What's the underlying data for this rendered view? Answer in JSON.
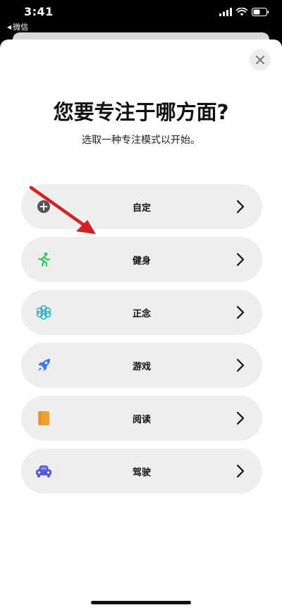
{
  "status_bar": {
    "time": "3:41",
    "back_app": "微信"
  },
  "sheet": {
    "title": "您要专注于哪方面?",
    "subtitle": "选取一种专注模式以开始。"
  },
  "focus_modes": [
    {
      "label": "自定",
      "icon": "plus-circle-icon",
      "color": "#555555"
    },
    {
      "label": "健身",
      "icon": "running-figure-icon",
      "color": "#34c759"
    },
    {
      "label": "正念",
      "icon": "flower-icon",
      "color": "#30b0c7"
    },
    {
      "label": "游戏",
      "icon": "rocket-icon",
      "color": "#3478f6"
    },
    {
      "label": "阅读",
      "icon": "book-icon",
      "color": "#f0a030"
    },
    {
      "label": "驾驶",
      "icon": "car-icon",
      "color": "#5a5ad6"
    }
  ],
  "colors": {
    "annotation_arrow": "#d42020",
    "item_background": "#eeeeee"
  }
}
